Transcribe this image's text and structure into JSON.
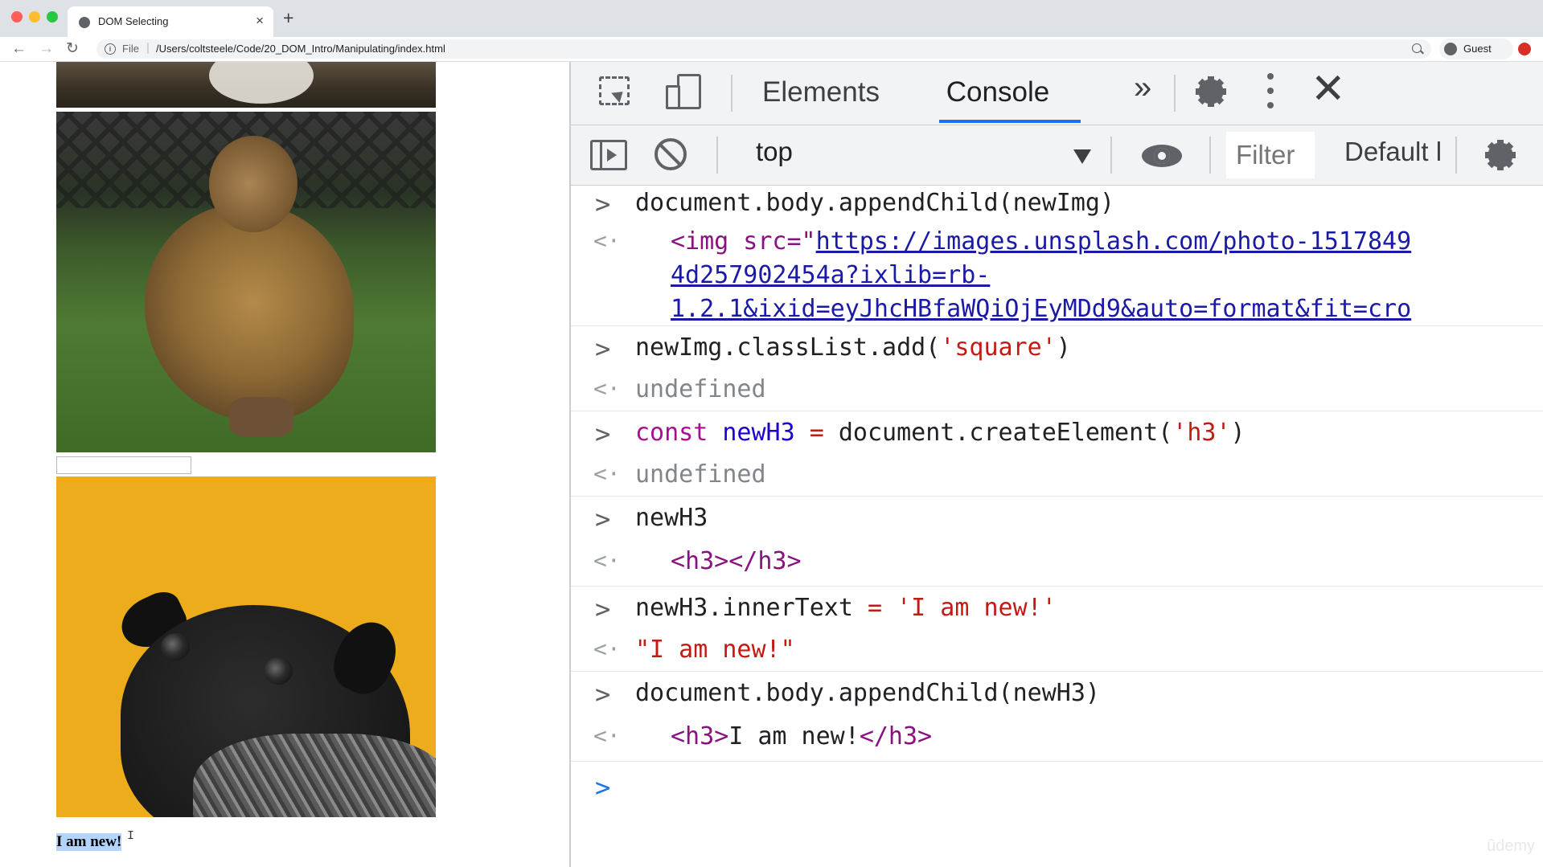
{
  "browser": {
    "tab_title": "DOM Selecting",
    "tab_close": "×",
    "new_tab": "+",
    "url_scheme": "File",
    "url_sep": "|",
    "url_path": "/Users/coltsteele/Code/20_DOM_Intro/Manipulating/index.html",
    "profile_name": "Guest",
    "nav": {
      "back": "←",
      "forward": "→",
      "reload": "↻"
    }
  },
  "page": {
    "h3_text": "I am new!",
    "text_cursor": "I"
  },
  "devtools": {
    "tabs": {
      "elements": "Elements",
      "console": "Console",
      "more": "»"
    },
    "close": "✕",
    "toolbar": {
      "context": "top",
      "filter_placeholder": "Filter",
      "levels": "Default levels"
    },
    "console": {
      "prompt_glyph": ">",
      "result_glyph": "<·",
      "entries": [
        {
          "input": "document.body.appendChild(newImg)",
          "output_line1_pre": "<img src=\"",
          "output_line1_link": "https://images.unsplash.com/photo-1517849",
          "output_line2": "4d257902454a?ixlib=rb-",
          "output_line3": "1.2.1&ixid=eyJhcHBfaWQiOjEyMDd9&auto=format&fit=cro"
        },
        {
          "input_pre": "newImg.classList.add(",
          "input_str": "'square'",
          "input_post": ")",
          "output": "undefined"
        },
        {
          "input_kw": "const",
          "input_var": " newH3 ",
          "input_eq": "=",
          "input_mid": " document.createElement(",
          "input_str": "'h3'",
          "input_post": ")",
          "output": "undefined"
        },
        {
          "input": "newH3",
          "output_open": "<h3>",
          "output_close": "</h3>"
        },
        {
          "input_pre": "newH3.innerText ",
          "input_eq": "=",
          "input_str": " 'I am new!'",
          "output": "\"I am new!\""
        },
        {
          "input": "document.body.appendChild(newH3)",
          "output_open": "<h3>",
          "output_text": "I am new!",
          "output_close": "</h3>"
        }
      ]
    }
  },
  "watermark": "ûdemy",
  "colors": {
    "accent": "#1a73e8",
    "string": "#c41a16",
    "keyword": "#aa0d91",
    "tag": "#881280",
    "pug_background": "#ecac1c",
    "selection": "#b3d4fc"
  }
}
